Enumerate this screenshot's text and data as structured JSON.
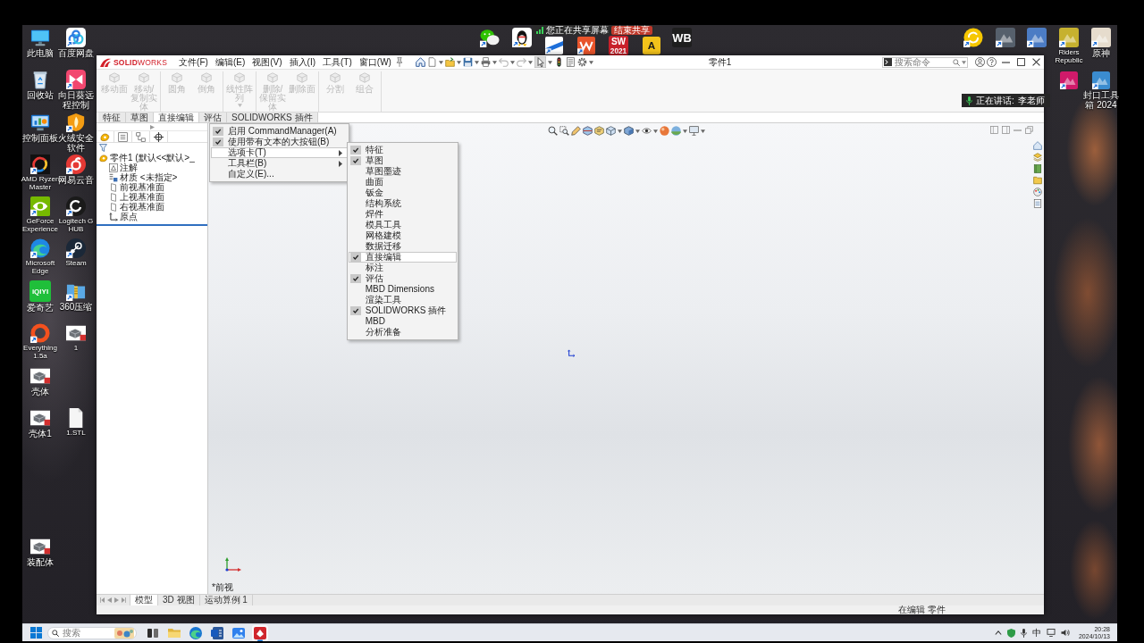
{
  "screen_share": {
    "text": "您正在共享屏幕",
    "button": "结束共享"
  },
  "desktop_icons": [
    {
      "kind": "monitor",
      "label": "此电脑"
    },
    {
      "kind": "rings",
      "label": "百度网盘"
    },
    {
      "kind": "chat"
    },
    {
      "kind": "penguin"
    },
    {
      "kind": "stripe"
    },
    {
      "kind": "zigzag"
    },
    {
      "kind": "glyph",
      "color": "#c8202a",
      "glyph": [
        "SW",
        "2021"
      ]
    },
    {
      "kind": "glyph",
      "color": "#f2c21b",
      "glyph": [
        "A"
      ]
    },
    {
      "kind": "glyph",
      "color": "#1e1e1e",
      "glyph": [
        "WB"
      ]
    },
    {
      "kind": "cycle"
    },
    {
      "kind": "tile",
      "color": "#56606c"
    },
    {
      "kind": "tile",
      "color": "#4c7cc4"
    },
    {
      "kind": "tile",
      "color": "#c6b12f",
      "label": "Riders Republic"
    },
    {
      "kind": "tile",
      "color": "#e6dccd",
      "label": "原神"
    },
    {
      "kind": "recycle-bin",
      "label": "回收站"
    },
    {
      "kind": "bowtie",
      "label": "向日葵远程控制"
    },
    {
      "kind": "tile",
      "color": "#d01a6a"
    },
    {
      "kind": "tile",
      "color": "#3b8ccf",
      "label": "封口工具箱 2024"
    },
    {
      "kind": "control-panel",
      "label": "控制面板"
    },
    {
      "kind": "shield",
      "label": "火绒安全软件"
    },
    {
      "kind": "arc",
      "label": "AMD Ryzen Master"
    },
    {
      "kind": "swirl",
      "label": "网易云音"
    },
    {
      "kind": "eye",
      "label": "GeForce Experience"
    },
    {
      "kind": "hook",
      "label": "Logitech G HUB"
    },
    {
      "kind": "wave",
      "label": "Microsoft Edge"
    },
    {
      "kind": "links",
      "label": "Steam"
    },
    {
      "kind": "glyph",
      "color": "#1fbf3a",
      "glyph": [
        "iQIYI"
      ],
      "label": "爱奇艺"
    },
    {
      "kind": "zip",
      "label": "360压缩"
    },
    {
      "kind": "ring",
      "label": "Everything 1.5a"
    },
    {
      "kind": "part-file",
      "label": "1"
    },
    {
      "kind": "part-file",
      "label": "壳体"
    },
    {
      "kind": "part-file",
      "label": "壳体1"
    },
    {
      "kind": "document",
      "label": "1.STL"
    },
    {
      "kind": "part-file",
      "label": "装配体"
    }
  ],
  "window": {
    "brand": "**SOLID**WORKS",
    "menu": [
      "文件(F)",
      "编辑(E)",
      "视图(V)",
      "插入(I)",
      "工具(T)",
      "窗口(W)"
    ],
    "title": "零件1",
    "search": {
      "placeholder": "搜索命令"
    },
    "ribbon": [
      [
        {
          "label": "移动面",
          "disabled": true,
          "dropdown": false
        },
        {
          "label": "移动/复制实体",
          "disabled": true,
          "dropdown": false
        }
      ],
      [
        {
          "label": "圆角",
          "disabled": true,
          "dropdown": false
        },
        {
          "label": "倒角",
          "disabled": true,
          "dropdown": false
        }
      ],
      [
        {
          "label": "线性阵列",
          "disabled": true,
          "dropdown": true
        }
      ],
      [
        {
          "label": "删除/保留实体",
          "disabled": true,
          "dropdown": false
        },
        {
          "label": "删除面",
          "disabled": true,
          "dropdown": false
        }
      ],
      [
        {
          "label": "分割",
          "disabled": true,
          "dropdown": false
        },
        {
          "label": "组合",
          "disabled": true,
          "dropdown": false
        }
      ]
    ],
    "ribbon_tabs": [
      {
        "label": "特征",
        "selected": false
      },
      {
        "label": "草图",
        "selected": false
      },
      {
        "label": "直接编辑",
        "selected": true
      },
      {
        "label": "评估",
        "selected": false
      },
      {
        "label": "SOLIDWORKS 插件",
        "selected": false
      }
    ],
    "feature_tree": {
      "label": "零件1 (默认<<默认>_",
      "children": [
        {
          "label": "注解",
          "kind": "annotations"
        },
        {
          "label": "材质 <未指定>",
          "kind": "material"
        },
        {
          "label": "前视基准面",
          "kind": "plane"
        },
        {
          "label": "上视基准面",
          "kind": "plane"
        },
        {
          "label": "右视基准面",
          "kind": "plane"
        },
        {
          "label": "原点",
          "kind": "origin"
        }
      ]
    },
    "view_label": "*前视",
    "bottom_tabs": [
      {
        "label": "模型",
        "selected": true
      },
      {
        "label": "3D 视图",
        "selected": false
      },
      {
        "label": "运动算例 1",
        "selected": false
      }
    ],
    "status": "在编辑 零件",
    "context_menu": [
      {
        "label": "启用 CommandManager(A)",
        "checked": true,
        "submenu": false,
        "highlighted": false
      },
      {
        "label": "使用带有文本的大按钮(B)",
        "checked": true,
        "submenu": false,
        "highlighted": false
      },
      {
        "label": "选项卡(T)",
        "checked": false,
        "submenu": true,
        "highlighted": true
      },
      {
        "label": "工具栏(B)",
        "checked": false,
        "submenu": true,
        "highlighted": false
      },
      {
        "label": "自定义(E)...",
        "checked": false,
        "submenu": false,
        "highlighted": false
      }
    ],
    "tabs_submenu": [
      {
        "label": "特征",
        "checked": true,
        "highlighted": false
      },
      {
        "label": "草图",
        "checked": true,
        "highlighted": false
      },
      {
        "label": "草图墨迹",
        "checked": false,
        "highlighted": false
      },
      {
        "label": "曲面",
        "checked": false,
        "highlighted": false
      },
      {
        "label": "钣金",
        "checked": false,
        "highlighted": false
      },
      {
        "label": "结构系统",
        "checked": false,
        "highlighted": false
      },
      {
        "label": "焊件",
        "checked": false,
        "highlighted": false
      },
      {
        "label": "模具工具",
        "checked": false,
        "highlighted": false
      },
      {
        "label": "网格建模",
        "checked": false,
        "highlighted": false
      },
      {
        "label": "数据迁移",
        "checked": false,
        "highlighted": false
      },
      {
        "label": "直接编辑",
        "checked": true,
        "highlighted": true
      },
      {
        "label": "标注",
        "checked": false,
        "highlighted": false
      },
      {
        "label": "评估",
        "checked": true,
        "highlighted": false
      },
      {
        "label": "MBD Dimensions",
        "checked": false,
        "highlighted": false
      },
      {
        "label": "渲染工具",
        "checked": false,
        "highlighted": false
      },
      {
        "label": "SOLIDWORKS 插件",
        "checked": true,
        "highlighted": false
      },
      {
        "label": "MBD",
        "checked": false,
        "highlighted": false
      },
      {
        "label": "分析准备",
        "checked": false,
        "highlighted": false
      }
    ]
  },
  "speaking": {
    "label": "正在讲话:",
    "name": "李老师"
  },
  "taskbar": {
    "search": {
      "placeholder": "搜索"
    },
    "apps": [
      {
        "kind": "task-view",
        "active": false
      },
      {
        "kind": "folder",
        "active": false
      },
      {
        "kind": "edge",
        "active": false
      },
      {
        "kind": "word",
        "active": false
      },
      {
        "kind": "photos",
        "active": false
      },
      {
        "kind": "solidworks",
        "active": true
      }
    ],
    "ime": "中",
    "time": "20:28",
    "date": "2024/10/13"
  }
}
